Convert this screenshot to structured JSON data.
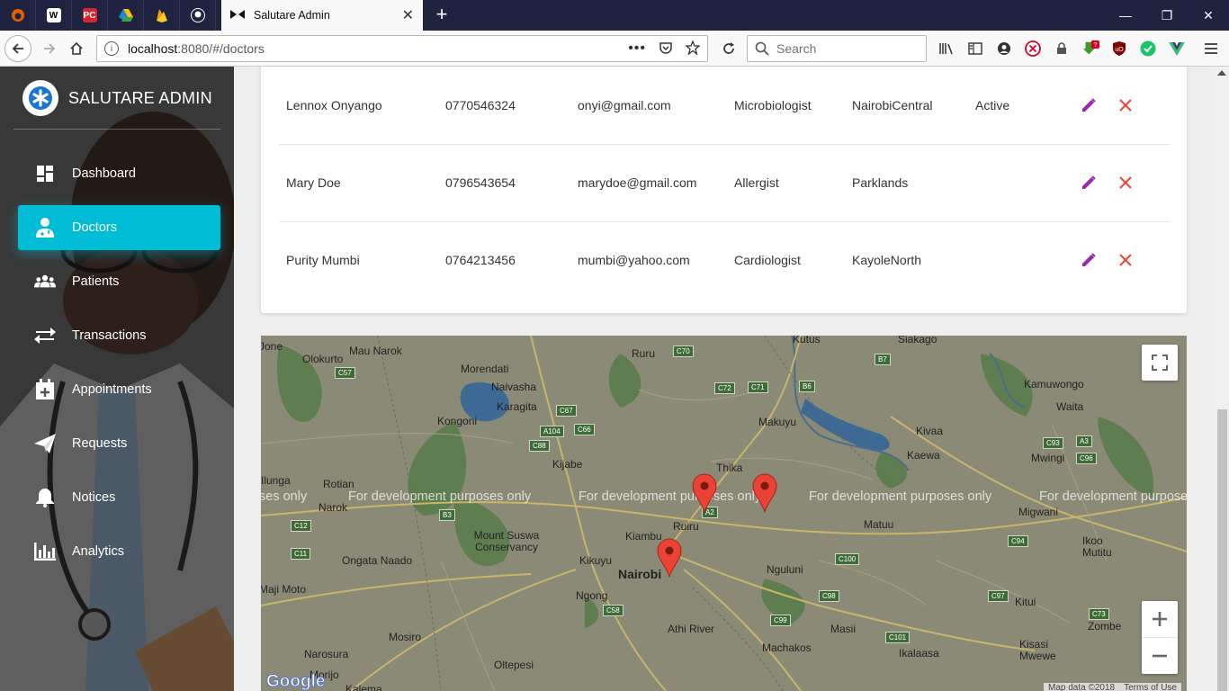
{
  "browser": {
    "tab_title": "Salutare Admin",
    "url_host": "localhost",
    "url_rest": ":8080/#/doctors",
    "search_placeholder": "Search",
    "pinned_tabs": [
      {
        "icon": "firefox-dev-icon"
      },
      {
        "icon": "wikipedia-icon",
        "text": "W"
      },
      {
        "icon": "pcgamer-icon",
        "text": "PC"
      },
      {
        "icon": "google-drive-icon"
      },
      {
        "icon": "firebase-icon"
      },
      {
        "icon": "github-icon"
      }
    ]
  },
  "sidebar": {
    "brand": "SALUTARE ADMIN",
    "items": [
      {
        "label": "Dashboard",
        "icon": "dashboard-icon"
      },
      {
        "label": "Doctors",
        "icon": "doctor-icon",
        "active": true
      },
      {
        "label": "Patients",
        "icon": "patients-icon"
      },
      {
        "label": "Transactions",
        "icon": "transactions-icon"
      },
      {
        "label": "Appointments",
        "icon": "calendar-plus-icon"
      },
      {
        "label": "Requests",
        "icon": "send-icon"
      },
      {
        "label": "Notices",
        "icon": "bell-icon"
      },
      {
        "label": "Analytics",
        "icon": "bar-chart-icon"
      }
    ],
    "accent_color": "#00bcd4"
  },
  "doctors": [
    {
      "name": "Lennox Onyango",
      "phone": "0770546324",
      "email": "onyi@gmail.com",
      "specialty": "Microbiologist",
      "location": "NairobiCentral",
      "status": "Active"
    },
    {
      "name": "Mary Doe",
      "phone": "0796543654",
      "email": "marydoe@gmail.com",
      "specialty": "Allergist",
      "location": "Parklands",
      "status": ""
    },
    {
      "name": "Purity Mumbi",
      "phone": "0764213456",
      "email": "mumbi@yahoo.com",
      "specialty": "Cardiologist",
      "location": "KayoleNorth",
      "status": ""
    }
  ],
  "row_colors": {
    "edit": "#9c27b0",
    "delete": "#f44336"
  },
  "map": {
    "watermark": "For development purposes only",
    "watermark_partial_left": "ses only",
    "watermark_partial_right": "For development purpose",
    "google_logo": "Google",
    "attribution": "Map data ©2018",
    "terms": "Terms of Use",
    "places": [
      "Jone",
      "Mau Narok",
      "Olokurto",
      "Morendati",
      "Naivasha",
      "Karagita",
      "Kongoni",
      "Ruru",
      "Kutus",
      "Siakago",
      "Kamuwongo",
      "Waita",
      "Makuyu",
      "Kivaa",
      "Kaewa",
      "Mwingi",
      "Kijabe",
      "Thika",
      "Rotian",
      "Narok",
      "Ilunga",
      "Ruiru",
      "Kiambu",
      "Mount Suswa Conservancy",
      "Ongata Naado",
      "Kikuyu",
      "Nairobi",
      "Matuu",
      "Migwani",
      "Ikoo Mutitu",
      "Nguluni",
      "Ngong",
      "Maji Moto",
      "Athi River",
      "Masii",
      "Kitui",
      "Zombe",
      "Mosiro",
      "Narosura",
      "Machakos",
      "Ikalaasa",
      "Kisasi Mwewe",
      "Oltepesi",
      "Morijo",
      "Kalema"
    ],
    "roads": [
      "C57",
      "C70",
      "C72",
      "C71",
      "C67",
      "A104",
      "C66",
      "C88",
      "B3",
      "C12",
      "C11",
      "A2",
      "C100",
      "C98",
      "C99",
      "C97",
      "C101",
      "C93",
      "A3",
      "C96",
      "C94",
      "C58",
      "B6",
      "B7",
      "C73"
    ]
  }
}
